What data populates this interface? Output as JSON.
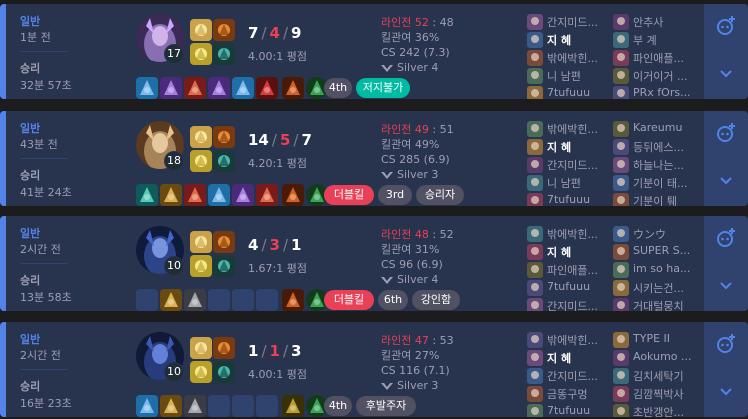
{
  "games": [
    {
      "queue": "일반",
      "ago": "1분 전",
      "result": "승리",
      "duration": "32분 57초",
      "champ_level": "17",
      "kills": "7",
      "deaths": "4",
      "assists": "9",
      "kda_ratio": "4.00:1 평점",
      "lane_label": "라인전",
      "lane_a": "52",
      "lane_b": "48",
      "kill_part": "킬관여 36%",
      "cs": "CS 242 (7.3)",
      "tier": "Silver 4",
      "badges": [
        {
          "text": "4th",
          "kind": "grey"
        },
        {
          "text": "저지불가",
          "kind": "green"
        }
      ],
      "items": [
        "blue",
        "purple",
        "red",
        "purple",
        "blue",
        "red-round",
        "orange-dot",
        "green-ward"
      ],
      "team_a": [
        "간지미드...",
        "지 혜",
        "밖에박힌...",
        "니 남편",
        "7tufuuu"
      ],
      "team_b": [
        "안추사",
        "부 계",
        "파인애플...",
        "이거이거 ...",
        "PRx fOrs..."
      ]
    },
    {
      "queue": "일반",
      "ago": "43분 전",
      "result": "승리",
      "duration": "41분 24초",
      "champ_level": "18",
      "kills": "14",
      "deaths": "5",
      "assists": "7",
      "kda_ratio": "4.20:1 평점",
      "lane_label": "라인전",
      "lane_a": "49",
      "lane_b": "51",
      "kill_part": "킬관여 49%",
      "cs": "CS 285 (6.9)",
      "tier": "Silver 3",
      "badges": [
        {
          "text": "더블킬",
          "kind": "red"
        },
        {
          "text": "3rd",
          "kind": "grey"
        },
        {
          "text": "승리자",
          "kind": "grey"
        }
      ],
      "items": [
        "teal",
        "gold",
        "red",
        "blue",
        "purple",
        "red",
        "orange-dot",
        "green-ward"
      ],
      "team_a": [
        "밖에박힌...",
        "지 혜",
        "간지미드...",
        "니 남편",
        "7tufuuu"
      ],
      "team_b": [
        "Kareumu",
        "등뒤에스...",
        "하늘나는...",
        "기분이 태...",
        "기분이 퉤"
      ]
    },
    {
      "queue": "일반",
      "ago": "2시간 전",
      "result": "승리",
      "duration": "13분 58초",
      "champ_level": "10",
      "kills": "4",
      "deaths": "3",
      "assists": "1",
      "kda_ratio": "1.67:1 평점",
      "lane_label": "라인전",
      "lane_a": "48",
      "lane_b": "52",
      "kill_part": "킬관여 31%",
      "cs": "CS 96 (6.9)",
      "tier": "Silver 4",
      "badges": [
        {
          "text": "더블킬",
          "kind": "red"
        },
        {
          "text": "6th",
          "kind": "grey"
        },
        {
          "text": "강인함",
          "kind": "grey"
        }
      ],
      "items": [
        "empty",
        "gold",
        "grey",
        "empty",
        "empty",
        "empty",
        "orange-dot",
        "green-ward"
      ],
      "team_a": [
        "밖에박힌...",
        "지 혜",
        "파인애플...",
        "7tufuuu",
        "간지미드..."
      ],
      "team_b": [
        "ウンウ",
        "SUPER S...",
        "im so ha...",
        "시키는건...",
        "거대털뭉치"
      ]
    },
    {
      "queue": "일반",
      "ago": "2시간 전",
      "result": "승리",
      "duration": "16분 23초",
      "champ_level": "10",
      "kills": "1",
      "deaths": "1",
      "assists": "3",
      "kda_ratio": "4.00:1 평점",
      "lane_label": "라인전",
      "lane_a": "47",
      "lane_b": "53",
      "kill_part": "킬관여 27%",
      "cs": "CS 116 (7.1)",
      "tier": "Silver 3",
      "badges": [
        {
          "text": "4th",
          "kind": "grey"
        },
        {
          "text": "후발주자",
          "kind": "grey"
        }
      ],
      "items": [
        "blue",
        "gold",
        "grey",
        "empty",
        "empty",
        "empty",
        "gold-dot",
        "green-ward"
      ],
      "team_a": [
        "밖에박힌...",
        "지 혜",
        "간지미드...",
        "금똥구멍",
        "7tufuuu"
      ],
      "team_b": [
        "TYPE II",
        "Aokumo ...",
        "김치세탁기",
        "김깜찍박사",
        "초반갱안..."
      ]
    }
  ],
  "colors": {
    "win_bg": "#28344e",
    "win_bar": "#5383e8",
    "side_bg": "#2f436e",
    "deaths": "#e84057",
    "badge_green": "#00bba3",
    "badge_red": "#e84057",
    "badge_grey": "#515163"
  },
  "icons": {
    "add": "add-comparison-icon",
    "expand": "chevron-down-icon",
    "tier": "tier-emblem-icon"
  },
  "separator": "/"
}
